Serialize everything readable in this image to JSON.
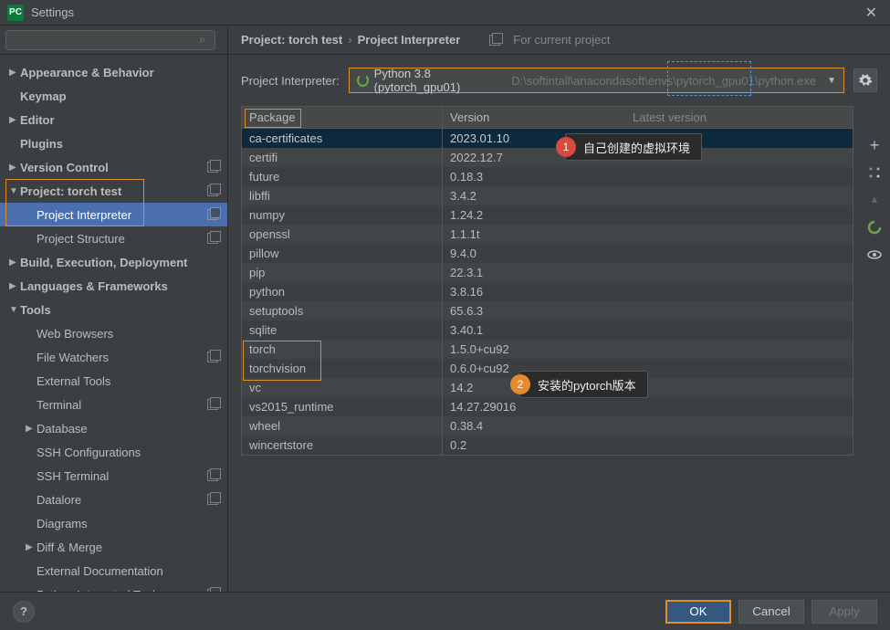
{
  "title": "Settings",
  "search_placeholder": "",
  "sidebar": {
    "items": [
      {
        "label": "Appearance & Behavior",
        "arrow": "▶",
        "bold": true
      },
      {
        "label": "Keymap",
        "arrow": "",
        "bold": true
      },
      {
        "label": "Editor",
        "arrow": "▶",
        "bold": true
      },
      {
        "label": "Plugins",
        "arrow": "",
        "bold": true
      },
      {
        "label": "Version Control",
        "arrow": "▶",
        "bold": true,
        "copy": true
      },
      {
        "label": "Project: torch test",
        "arrow": "▼",
        "bold": true,
        "copy": true
      },
      {
        "label": "Project Interpreter",
        "arrow": "",
        "ind": 1,
        "copy": true,
        "selected": true
      },
      {
        "label": "Project Structure",
        "arrow": "",
        "ind": 1,
        "copy": true
      },
      {
        "label": "Build, Execution, Deployment",
        "arrow": "▶",
        "bold": true
      },
      {
        "label": "Languages & Frameworks",
        "arrow": "▶",
        "bold": true
      },
      {
        "label": "Tools",
        "arrow": "▼",
        "bold": true
      },
      {
        "label": "Web Browsers",
        "arrow": "",
        "ind": 1
      },
      {
        "label": "File Watchers",
        "arrow": "",
        "ind": 1,
        "copy": true
      },
      {
        "label": "External Tools",
        "arrow": "",
        "ind": 1
      },
      {
        "label": "Terminal",
        "arrow": "",
        "ind": 1,
        "copy": true
      },
      {
        "label": "Database",
        "arrow": "▶",
        "ind": 1
      },
      {
        "label": "SSH Configurations",
        "arrow": "",
        "ind": 1
      },
      {
        "label": "SSH Terminal",
        "arrow": "",
        "ind": 1,
        "copy": true
      },
      {
        "label": "Datalore",
        "arrow": "",
        "ind": 1,
        "copy": true
      },
      {
        "label": "Diagrams",
        "arrow": "",
        "ind": 1
      },
      {
        "label": "Diff & Merge",
        "arrow": "▶",
        "ind": 1
      },
      {
        "label": "External Documentation",
        "arrow": "",
        "ind": 1
      },
      {
        "label": "Python Integrated Tools",
        "arrow": "",
        "ind": 1,
        "copy": true
      }
    ]
  },
  "breadcrumb": {
    "a": "Project: torch test",
    "b": "Project Interpreter",
    "for": "For current project"
  },
  "interpreter": {
    "label": "Project Interpreter:",
    "name": "Python 3.8 (pytorch_gpu01)",
    "path": "D:\\softintall\\anacondasoft\\envs\\pytorch_gpu01\\python.exe"
  },
  "table": {
    "headers": {
      "pkg": "Package",
      "ver": "Version",
      "lat": "Latest version"
    },
    "rows": [
      {
        "pkg": "ca-certificates",
        "ver": "2023.01.10"
      },
      {
        "pkg": "certifi",
        "ver": "2022.12.7"
      },
      {
        "pkg": "future",
        "ver": "0.18.3"
      },
      {
        "pkg": "libffi",
        "ver": "3.4.2"
      },
      {
        "pkg": "numpy",
        "ver": "1.24.2"
      },
      {
        "pkg": "openssl",
        "ver": "1.1.1t"
      },
      {
        "pkg": "pillow",
        "ver": "9.4.0"
      },
      {
        "pkg": "pip",
        "ver": "22.3.1"
      },
      {
        "pkg": "python",
        "ver": "3.8.16"
      },
      {
        "pkg": "setuptools",
        "ver": "65.6.3"
      },
      {
        "pkg": "sqlite",
        "ver": "3.40.1"
      },
      {
        "pkg": "torch",
        "ver": "1.5.0+cu92"
      },
      {
        "pkg": "torchvision",
        "ver": "0.6.0+cu92"
      },
      {
        "pkg": "vc",
        "ver": "14.2"
      },
      {
        "pkg": "vs2015_runtime",
        "ver": "14.27.29016"
      },
      {
        "pkg": "wheel",
        "ver": "0.38.4"
      },
      {
        "pkg": "wincertstore",
        "ver": "0.2"
      }
    ]
  },
  "callouts": {
    "c1": {
      "num": "1",
      "text": "自己创建的虚拟环境"
    },
    "c2": {
      "num": "2",
      "text": "安装的pytorch版本"
    }
  },
  "buttons": {
    "ok": "OK",
    "cancel": "Cancel",
    "apply": "Apply"
  },
  "icons": {
    "plus": "+",
    "minus": "−",
    "up": "▲",
    "eye": "◉"
  }
}
